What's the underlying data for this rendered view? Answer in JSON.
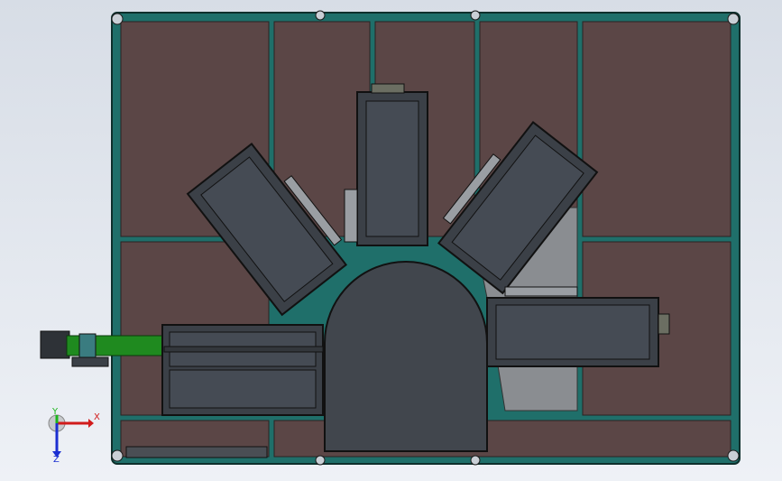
{
  "viewport": {
    "background_top": "#d7dde6",
    "background_bottom": "#eef1f6"
  },
  "model": {
    "floor_panel_color": "#5b4646",
    "frame_color": "#1f6f6a",
    "frame_edge_color": "#0e2f2c",
    "station_color": "#3b4047",
    "station_inner_color": "#454b54",
    "turntable_color": "#41464d",
    "conveyor_color": "#1f8a1f"
  },
  "triad": {
    "x_label": "X",
    "y_label": "Y",
    "z_label": "Z",
    "x_color": "#d11b1b",
    "y_color": "#1bb51b",
    "z_color": "#1b2fd1"
  }
}
